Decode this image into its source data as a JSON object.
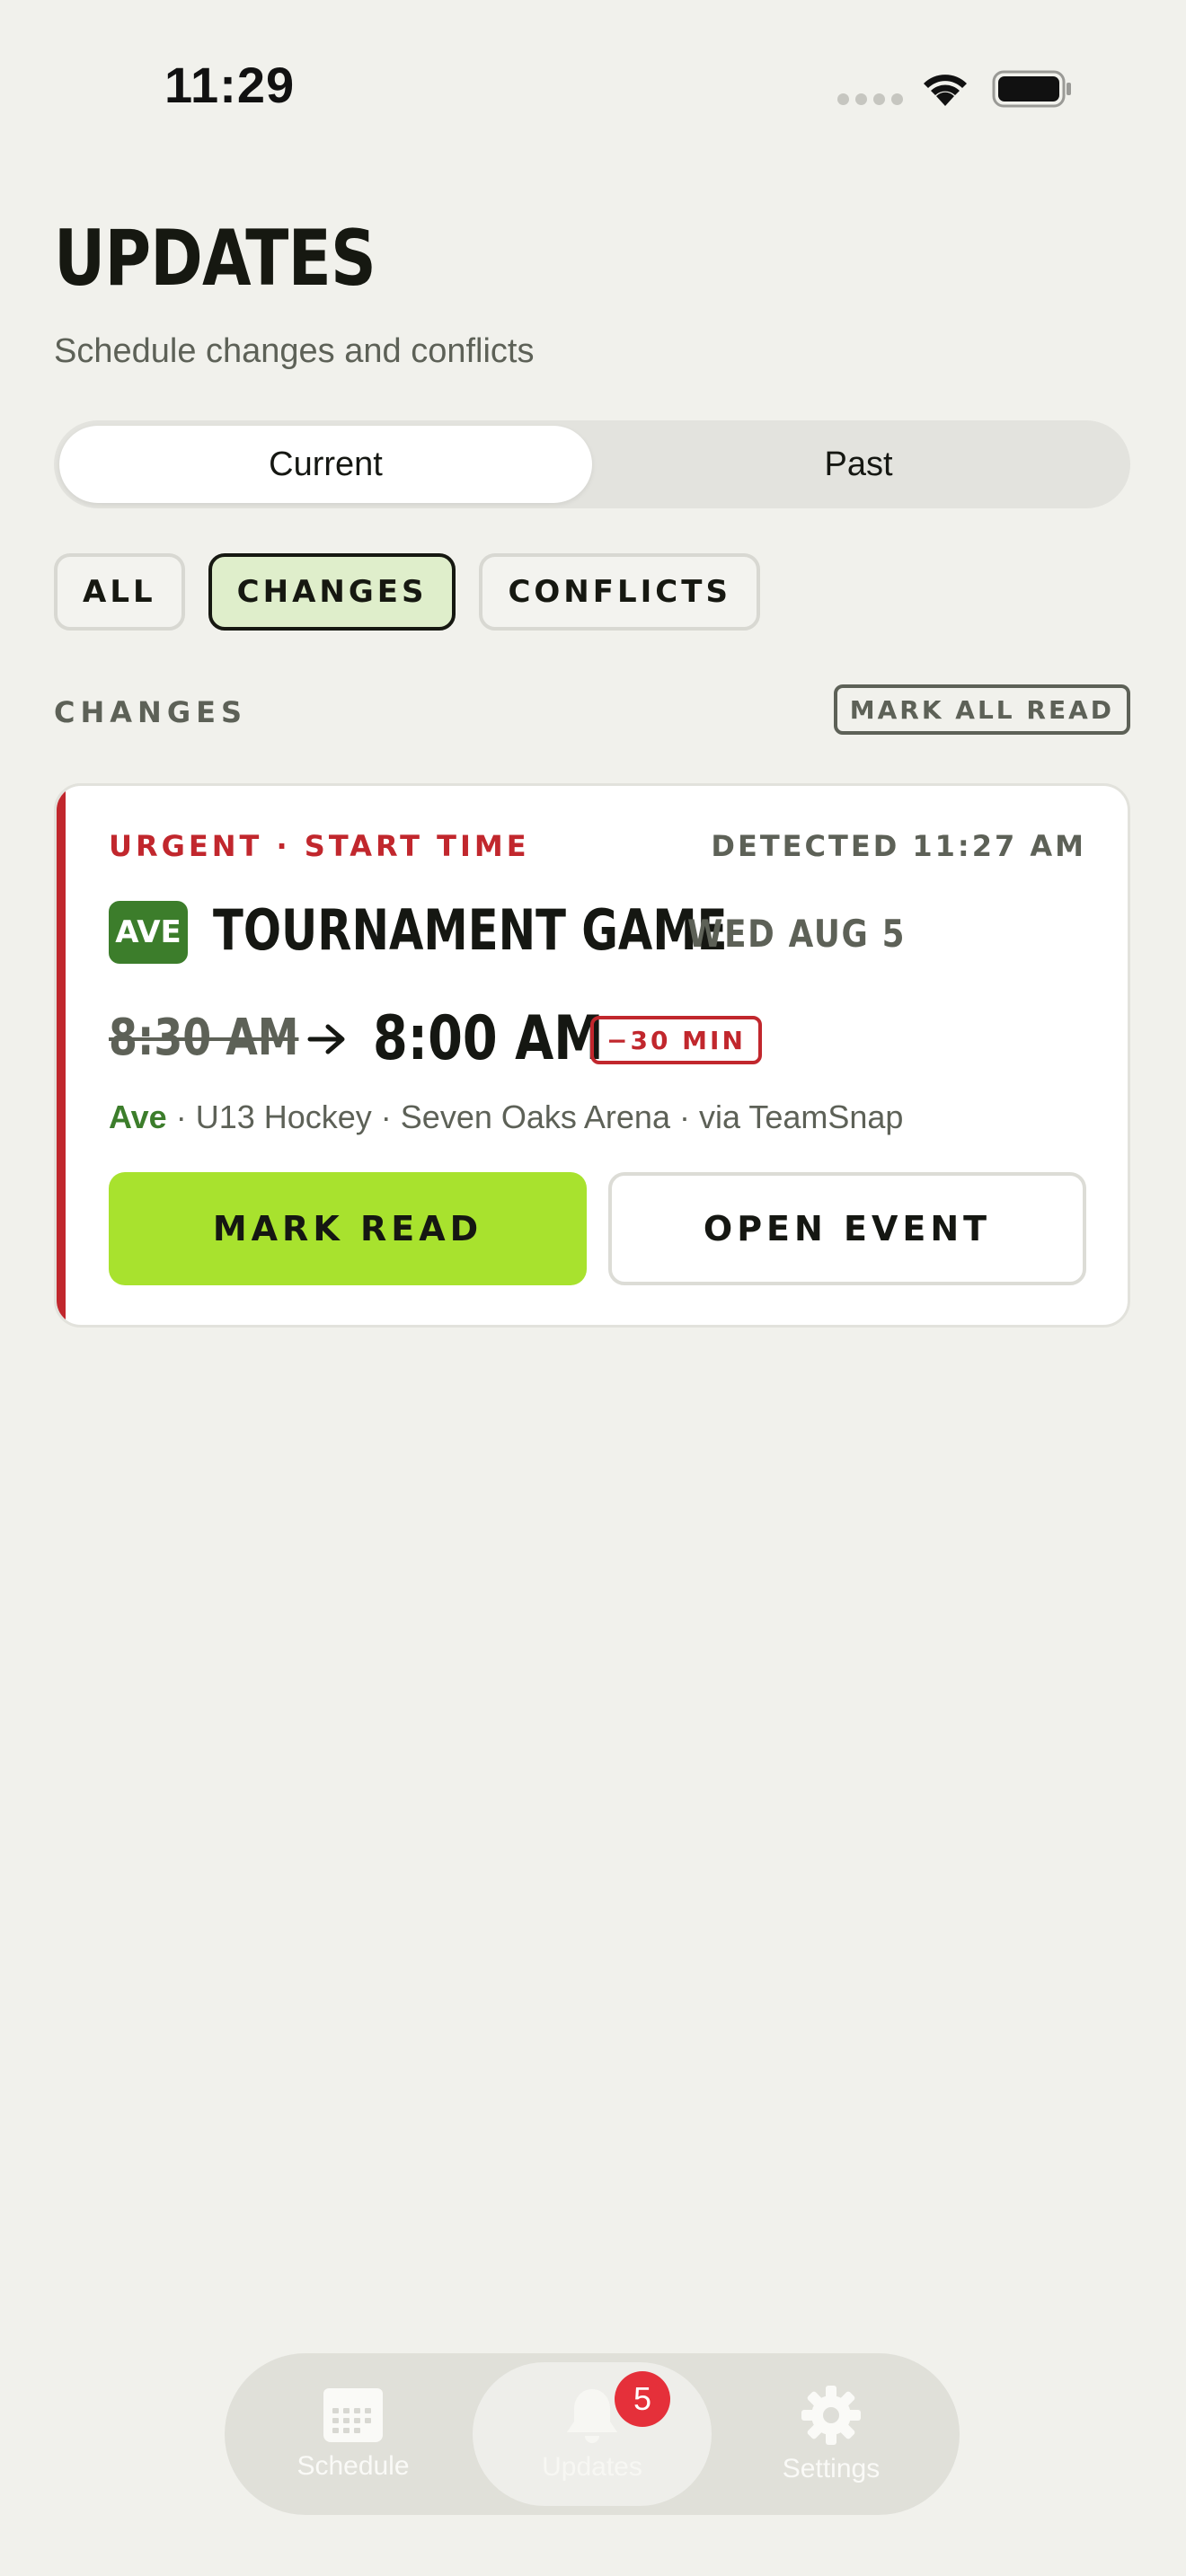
{
  "status_bar": {
    "time": "11:29"
  },
  "header": {
    "title": "UPDATES",
    "subtitle": "Schedule changes and conflicts"
  },
  "segmented": {
    "current": "Current",
    "past": "Past",
    "selected": "Current"
  },
  "filters": {
    "all": "ALL",
    "changes": "CHANGES",
    "conflicts": "CONFLICTS",
    "selected": "CHANGES"
  },
  "section": {
    "label": "CHANGES",
    "mark_all_read": "MARK ALL READ"
  },
  "card": {
    "tag": "URGENT · START TIME",
    "detected": "DETECTED 11:27 AM",
    "team_badge": "AVE",
    "event_title": "TOURNAMENT GAME",
    "event_date": "WED AUG 5",
    "old_time": "8:30 AM",
    "new_time": "8:00 AM",
    "delta": "−30 MIN",
    "team": "Ave",
    "meta": " · U13 Hockey · Seven Oaks Arena · via TeamSnap",
    "mark_read": "MARK READ",
    "open_event": "OPEN EVENT"
  },
  "tab_bar": {
    "schedule": "Schedule",
    "updates": "Updates",
    "updates_badge": "5",
    "settings": "Settings",
    "selected": "Updates"
  },
  "colors": {
    "accent_urgent": "#c1272d",
    "primary_button": "#a8e22e",
    "team": "#3c7d2b"
  }
}
